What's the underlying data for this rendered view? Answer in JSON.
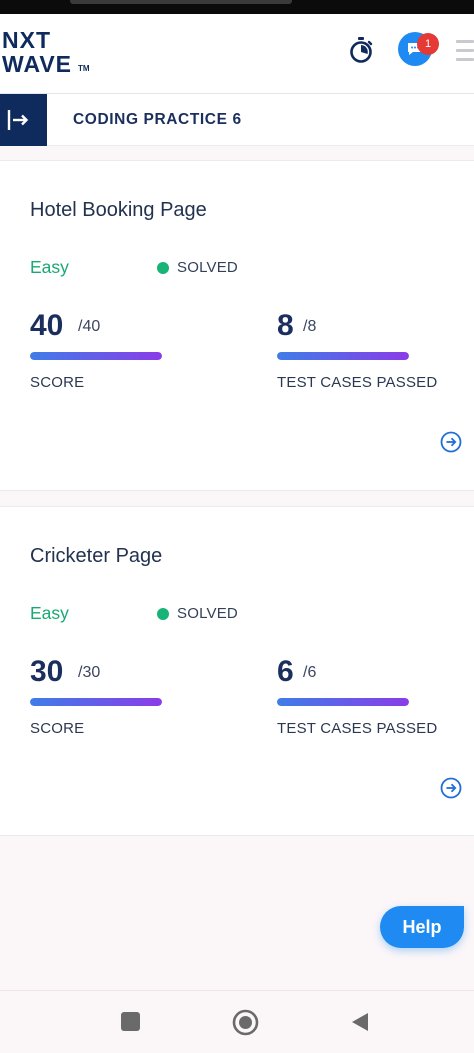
{
  "header": {
    "logo_line1": "NXT",
    "logo_line2": "WAVE",
    "logo_tm": "TM",
    "timer_icon": "stopwatch-icon",
    "chat_icon": "chat-bubble-icon",
    "notification_count": "1",
    "menu_icon": "hamburger-menu-icon"
  },
  "practice_bar": {
    "collapse_icon": "sidebar-expand-icon",
    "title": "CODING PRACTICE 6"
  },
  "questions": [
    {
      "title": "Hotel Booking Page",
      "difficulty": "Easy",
      "status": "SOLVED",
      "score": "40",
      "score_total": "/40",
      "score_label": "SCORE",
      "score_fraction": 1.0,
      "tests_passed": "8",
      "tests_total": "/8",
      "tests_label": "TEST CASES PASSED",
      "tests_fraction": 1.0
    },
    {
      "title": "Cricketer Page",
      "difficulty": "Easy",
      "status": "SOLVED",
      "score": "30",
      "score_total": "/30",
      "score_label": "SCORE",
      "score_fraction": 1.0,
      "tests_passed": "6",
      "tests_total": "/6",
      "tests_label": "TEST CASES PASSED",
      "tests_fraction": 1.0
    }
  ],
  "help_label": "Help",
  "colors": {
    "brand_navy": "#0f2a5c",
    "accent_blue": "#1f8bf2",
    "easy_green": "#19a974",
    "solved_green": "#18b376",
    "progress_start": "#3f7de8",
    "progress_end": "#8a3ce8",
    "badge_red": "#e53935"
  },
  "nav": {
    "recent_icon": "recent-apps-icon",
    "home_icon": "home-icon",
    "back_icon": "back-icon"
  }
}
